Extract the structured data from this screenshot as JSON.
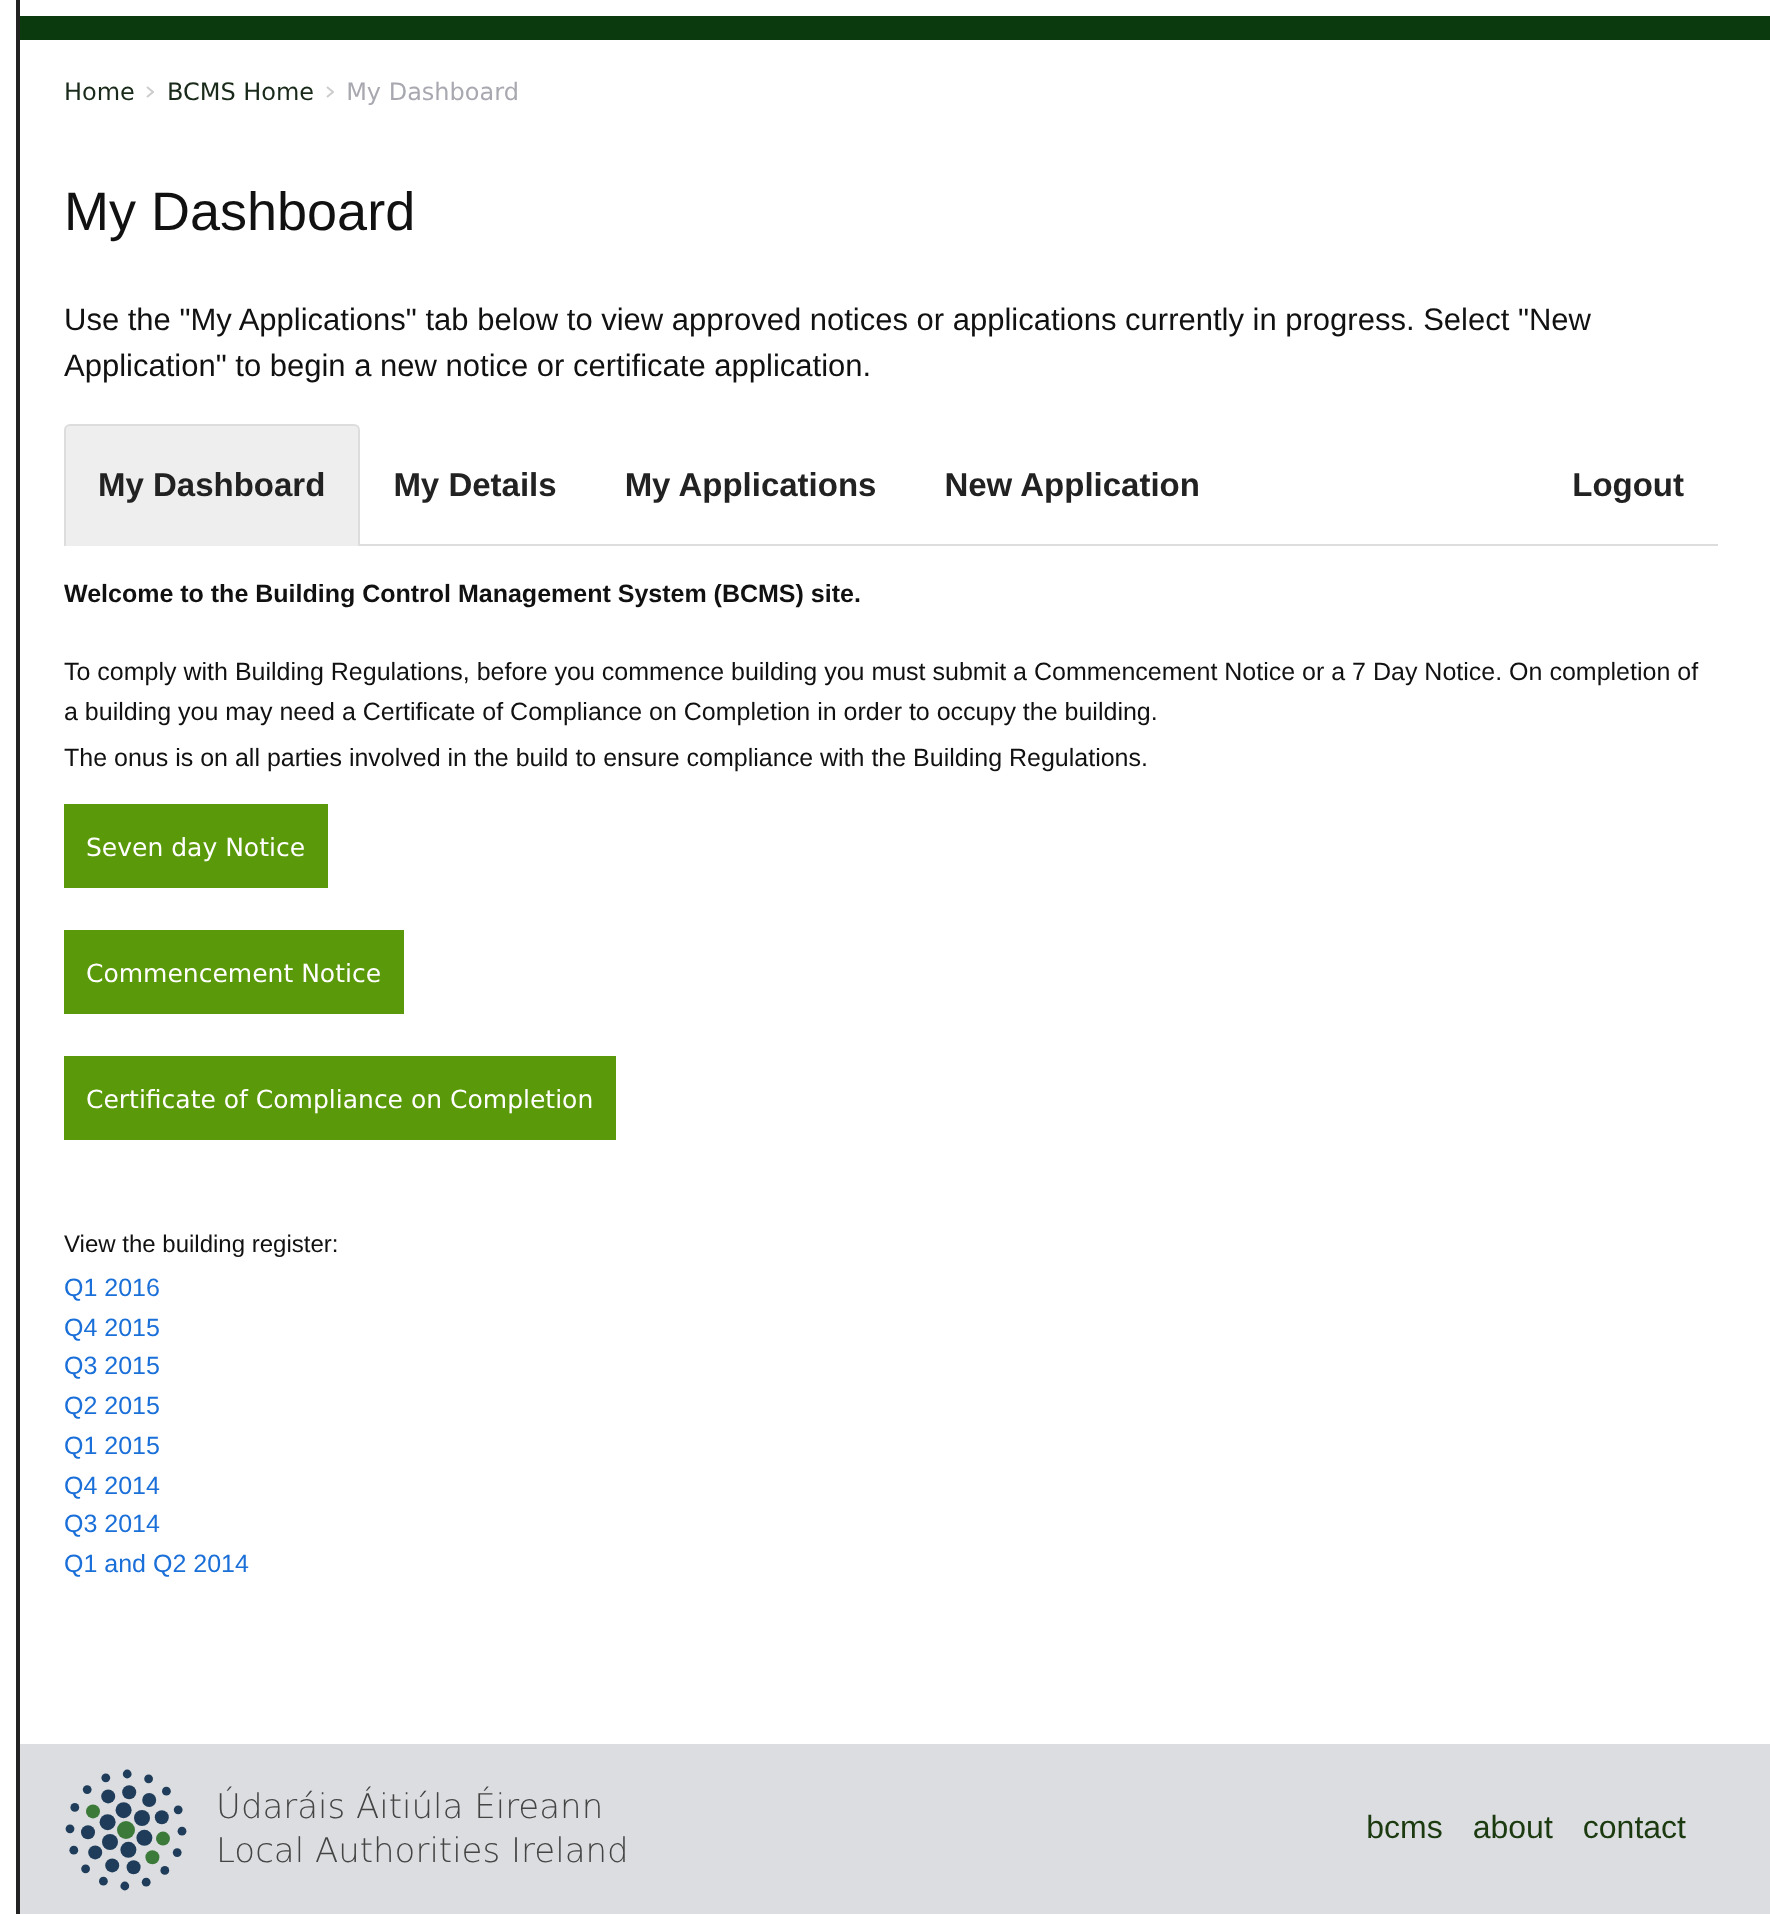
{
  "breadcrumb": [
    {
      "label": "Home",
      "current": false
    },
    {
      "label": "BCMS Home",
      "current": false
    },
    {
      "label": "My Dashboard",
      "current": true
    }
  ],
  "page_title": "My Dashboard",
  "intro": "Use the \"My Applications\" tab below to view approved notices or applications currently in progress. Select \"New Application\" to begin a new notice or certificate application.",
  "tabs": [
    {
      "label": "My Dashboard",
      "selected": true
    },
    {
      "label": "My Details",
      "selected": false
    },
    {
      "label": "My Applications",
      "selected": false
    },
    {
      "label": "New Application",
      "selected": false
    }
  ],
  "logout": "Logout",
  "welcome": "Welcome to the Building Control Management System (BCMS) site.",
  "paragraphs": [
    "To comply with Building Regulations, before you commence building you must submit a Commencement Notice or a 7 Day Notice.  On completion of a building you may need a Certificate of Compliance on Completion in order to occupy the building.",
    "The onus is on all parties involved in the build to ensure compliance with the Building Regulations."
  ],
  "buttons": [
    "Seven day Notice",
    "Commencement Notice",
    "Certificate of Compliance on Completion"
  ],
  "register": {
    "label": "View the building register:",
    "links": [
      "Q1 2016",
      "Q4 2015",
      "Q3 2015",
      "Q2 2015",
      "Q1 2015",
      "Q4 2014",
      "Q3 2014",
      "Q1 and Q2 2014"
    ]
  },
  "footer": {
    "logo_lines": [
      "Údaráis Áitiúla Éireann",
      "Local Authorities Ireland"
    ],
    "links": [
      "bcms",
      "about",
      "contact"
    ]
  }
}
